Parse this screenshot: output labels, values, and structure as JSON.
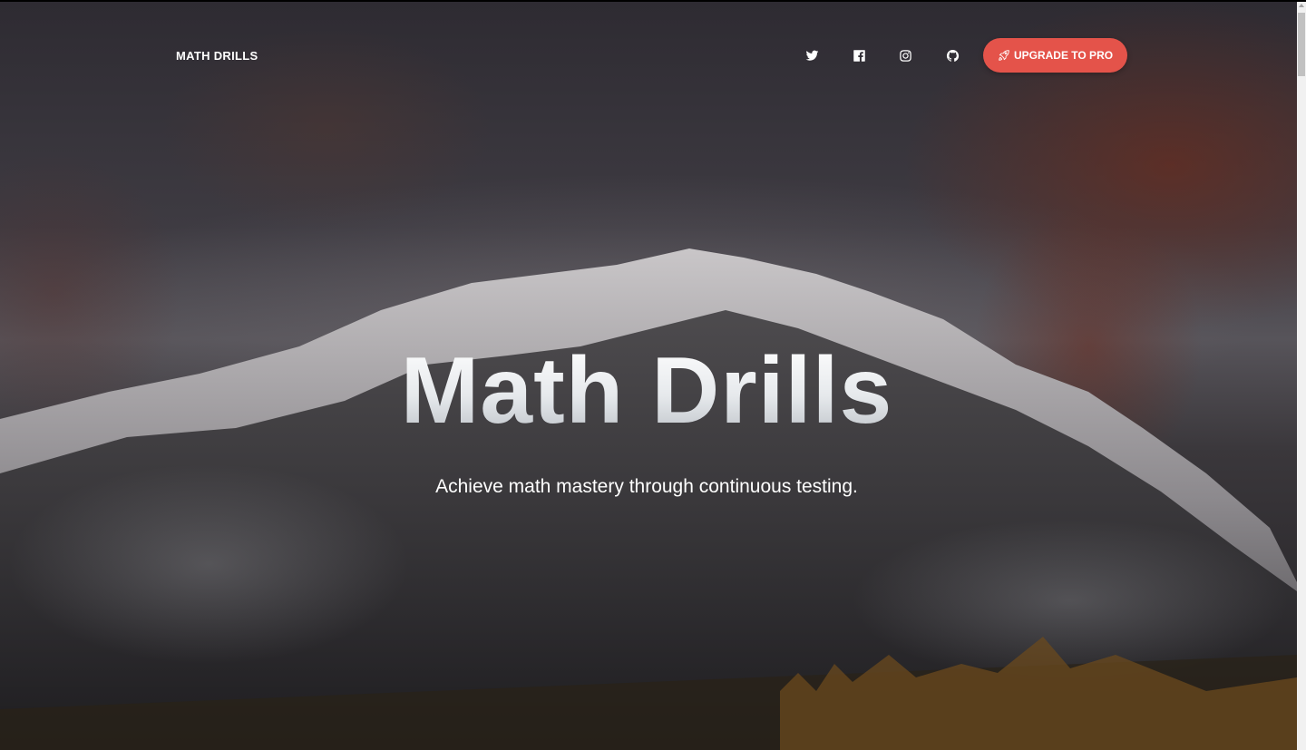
{
  "navbar": {
    "brand": "MATH DRILLS",
    "social_icons": [
      "twitter-icon",
      "facebook-icon",
      "instagram-icon",
      "github-icon"
    ],
    "upgrade_label": "UPGRADE TO PRO",
    "upgrade_icon": "rocket-icon"
  },
  "hero": {
    "title": "Math Drills",
    "subtitle": "Achieve math mastery through continuous testing."
  },
  "colors": {
    "accent": "#e4534a",
    "text": "#ffffff"
  }
}
